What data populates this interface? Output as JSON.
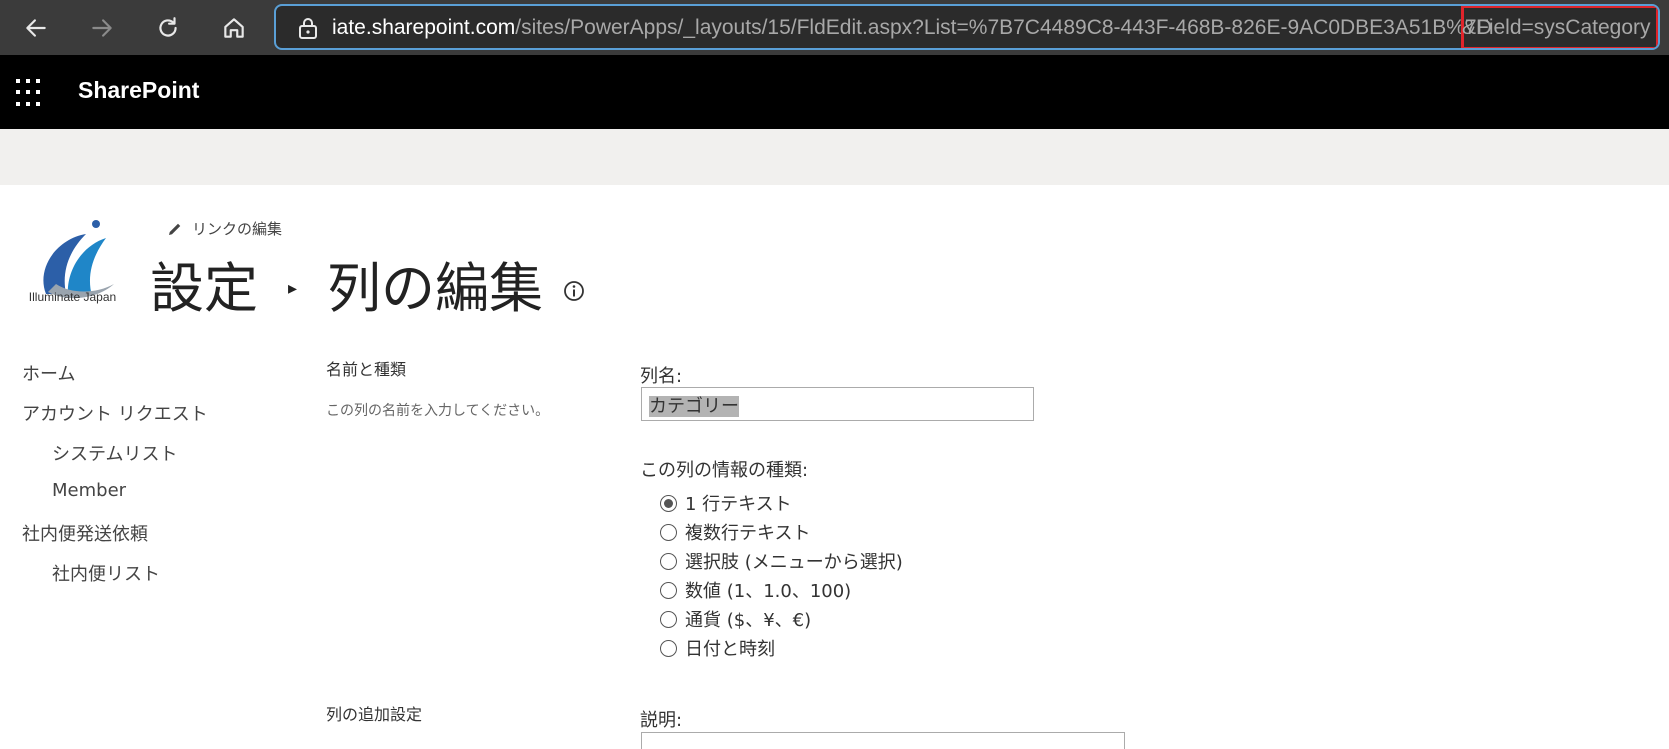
{
  "browser": {
    "url_host": "iate.sharepoint.com",
    "url_path": "/sites/PowerApps/_layouts/15/FldEdit.aspx?List=%7B7C4489C8-443F-468B-826E-9AC0DBE3A51B%7D",
    "url_highlighted_param": "&Field=sysCategory",
    "highlight_color": "#e0242b"
  },
  "suite": {
    "title": "SharePoint"
  },
  "site": {
    "logo_text": "Illuminate Japan",
    "edit_link": "リンクの編集",
    "breadcrumb": [
      "設定",
      "列の編集"
    ]
  },
  "left_nav": {
    "items": [
      {
        "label": "ホーム",
        "level": 0
      },
      {
        "label": "アカウント リクエスト",
        "level": 0
      },
      {
        "label": "システムリスト",
        "level": 1
      },
      {
        "label": "Member",
        "level": 1
      },
      {
        "label": "社内便発送依頼",
        "level": 0
      },
      {
        "label": "社内便リスト",
        "level": 1
      }
    ]
  },
  "form": {
    "name_section": {
      "title": "名前と種類",
      "description": "この列の名前を入力してください。"
    },
    "column_name_label": "列名:",
    "column_name_value": "カテゴリー",
    "type_label": "この列の情報の種類:",
    "type_options": [
      {
        "label": "1 行テキスト",
        "checked": true
      },
      {
        "label": "複数行テキスト",
        "checked": false
      },
      {
        "label": "選択肢 (メニューから選択)",
        "checked": false
      },
      {
        "label": "数値 (1、1.0、100)",
        "checked": false
      },
      {
        "label": "通貨 ($、¥、€)",
        "checked": false
      },
      {
        "label": "日付と時刻",
        "checked": false
      }
    ],
    "additional_section": {
      "title": "列の追加設定"
    },
    "description_label": "説明:"
  }
}
